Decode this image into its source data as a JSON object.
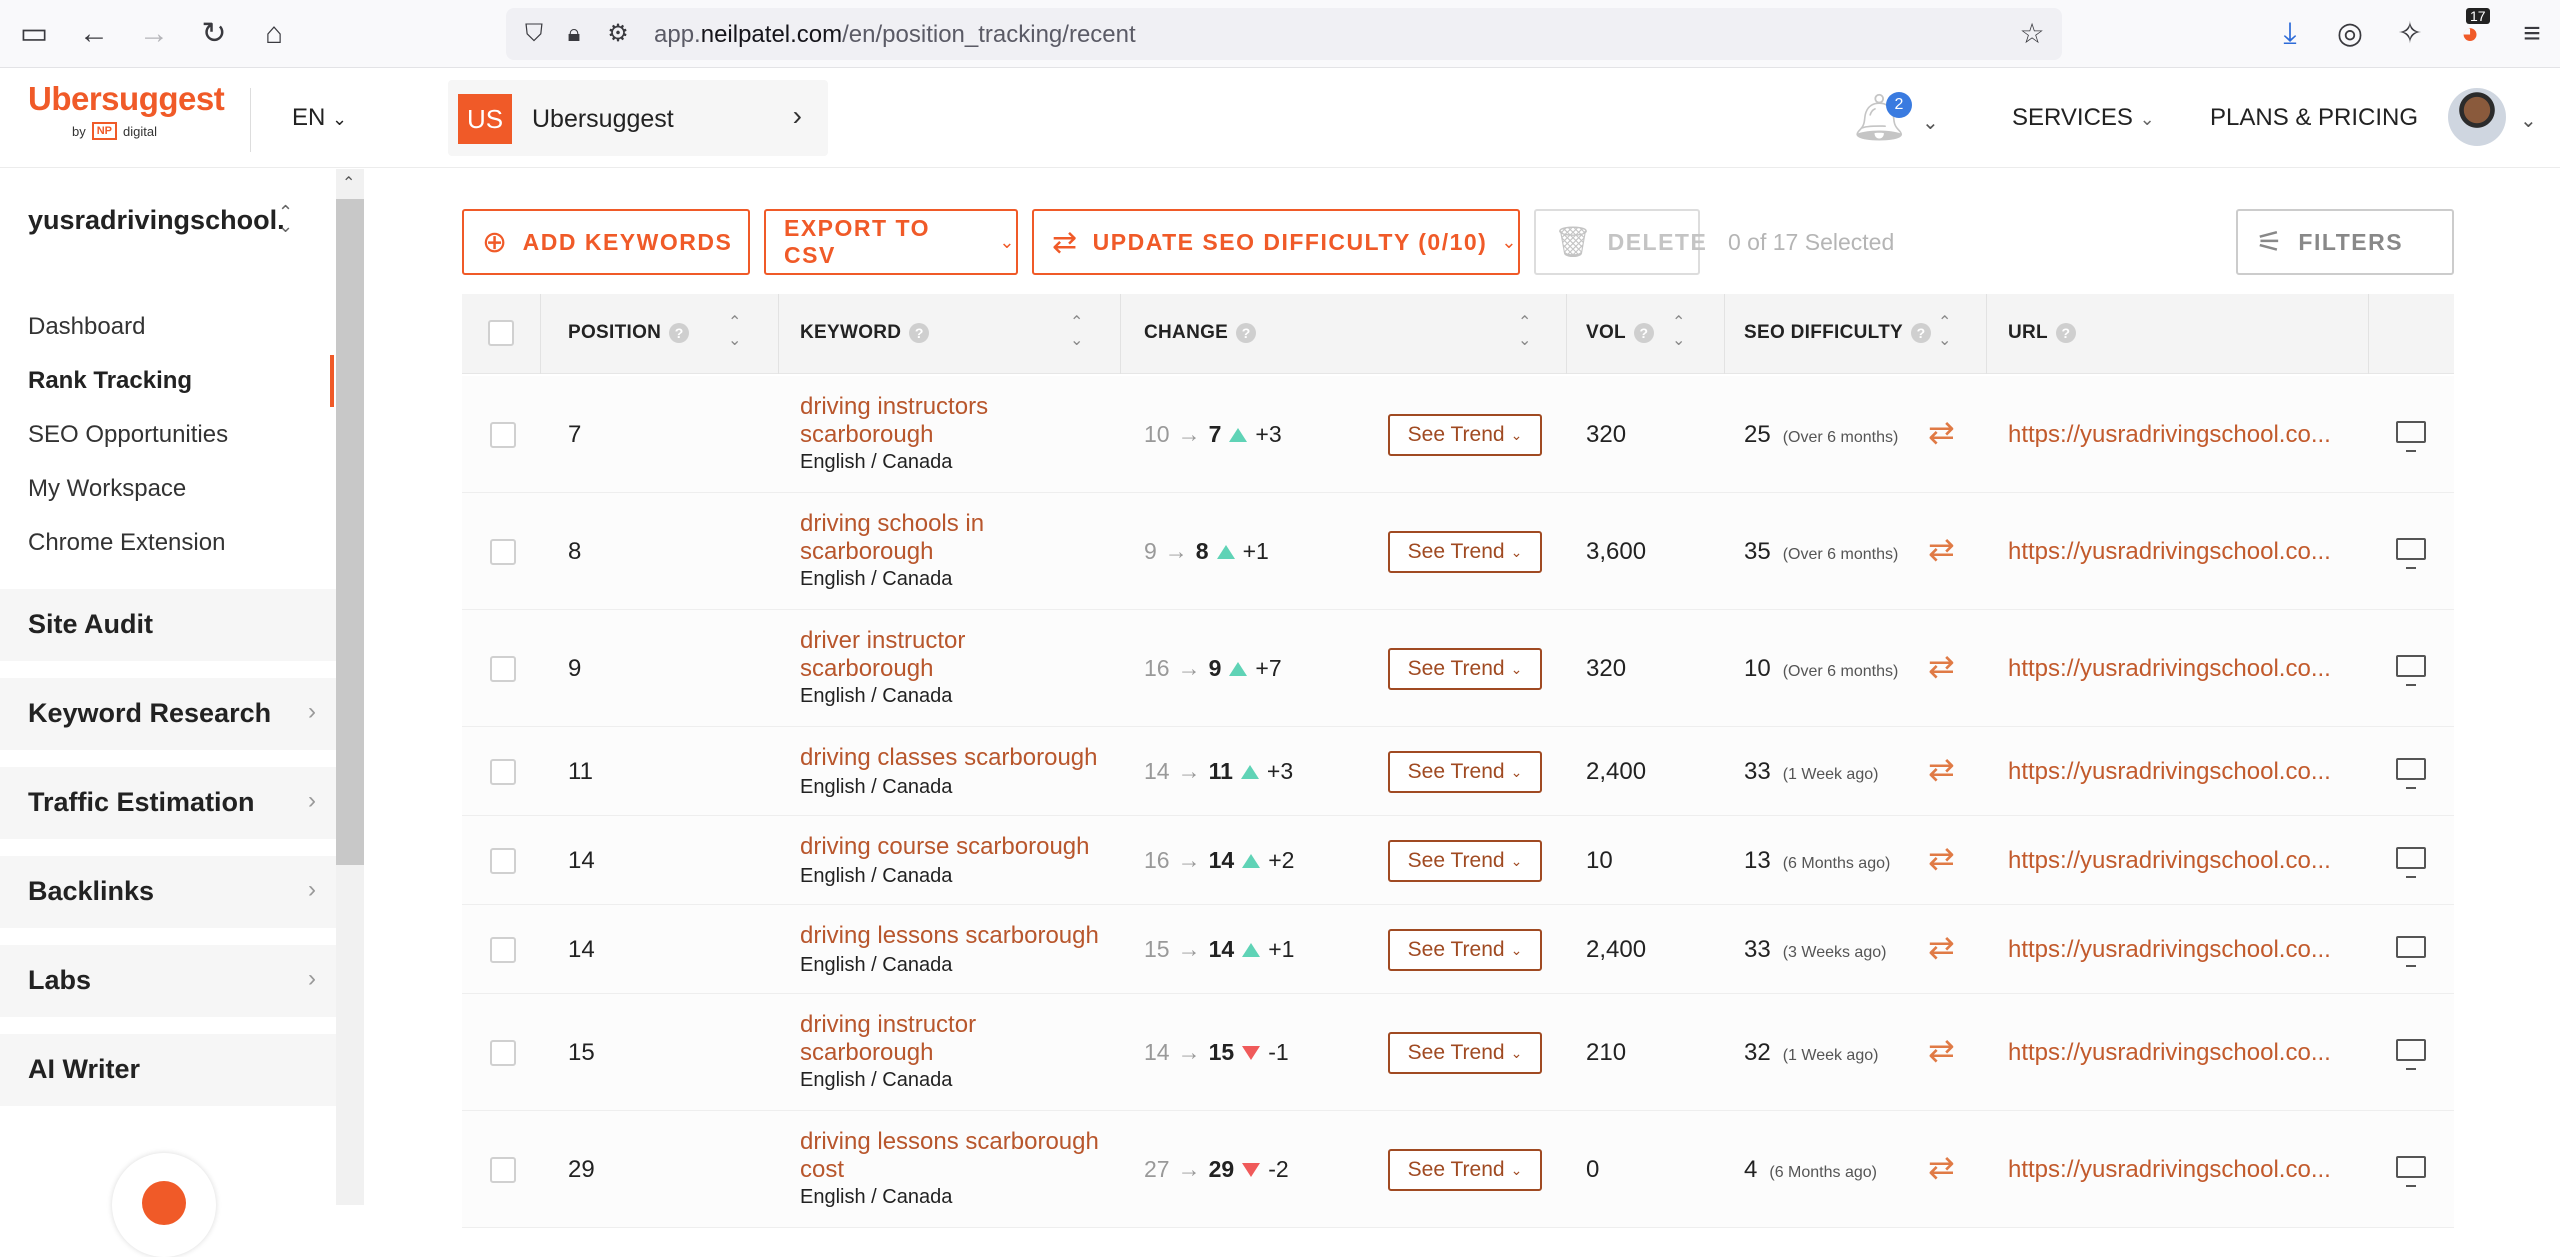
{
  "browser": {
    "url_prefix": "app.",
    "url_domain": "neilpatel.com",
    "url_path": "/en/position_tracking/recent",
    "extensions_badge": "17"
  },
  "header": {
    "logo": "Ubersuggest",
    "logo_by": "by",
    "logo_np": "NP",
    "logo_digital": "digital",
    "language": "EN",
    "project_badge": "US",
    "project_name": "Ubersuggest",
    "notifications_count": "2",
    "services": "SERVICES",
    "plans": "PLANS & PRICING"
  },
  "sidebar": {
    "site": "yusradrivingschool.",
    "items": [
      "Dashboard",
      "Rank Tracking",
      "SEO Opportunities",
      "My Workspace",
      "Chrome Extension"
    ],
    "sections": [
      "Site Audit",
      "Keyword Research",
      "Traffic Estimation",
      "Backlinks",
      "Labs",
      "AI Writer"
    ]
  },
  "toolbar": {
    "add_keywords": "ADD KEYWORDS",
    "export_csv": "EXPORT TO CSV",
    "update_seo": "UPDATE SEO DIFFICULTY (0/10)",
    "delete": "DELETE",
    "selected": "0 of 17 Selected",
    "filters": "FILTERS"
  },
  "table": {
    "columns": [
      "POSITION",
      "KEYWORD",
      "CHANGE",
      "VOL",
      "SEO DIFFICULTY",
      "URL"
    ],
    "trend_label": "See Trend",
    "rows": [
      {
        "position": "7",
        "kw1": "driving instructors",
        "kw2": "scarborough",
        "loc": "English / Canada",
        "from": "10",
        "to": "7",
        "dir": "up",
        "delta": "+3",
        "vol": "320",
        "sd": "25",
        "sd_note": "(Over 6 months)",
        "url": "https://yusradrivingschool.co..."
      },
      {
        "position": "8",
        "kw1": "driving schools in",
        "kw2": "scarborough",
        "loc": "English / Canada",
        "from": "9",
        "to": "8",
        "dir": "up",
        "delta": "+1",
        "vol": "3,600",
        "sd": "35",
        "sd_note": "(Over 6 months)",
        "url": "https://yusradrivingschool.co..."
      },
      {
        "position": "9",
        "kw1": "driver instructor",
        "kw2": "scarborough",
        "loc": "English / Canada",
        "from": "16",
        "to": "9",
        "dir": "up",
        "delta": "+7",
        "vol": "320",
        "sd": "10",
        "sd_note": "(Over 6 months)",
        "url": "https://yusradrivingschool.co..."
      },
      {
        "position": "11",
        "kw1": "driving classes scarborough",
        "kw2": "",
        "loc": "English / Canada",
        "from": "14",
        "to": "11",
        "dir": "up",
        "delta": "+3",
        "vol": "2,400",
        "sd": "33",
        "sd_note": "(1 Week ago)",
        "url": "https://yusradrivingschool.co..."
      },
      {
        "position": "14",
        "kw1": "driving course scarborough",
        "kw2": "",
        "loc": "English / Canada",
        "from": "16",
        "to": "14",
        "dir": "up",
        "delta": "+2",
        "vol": "10",
        "sd": "13",
        "sd_note": "(6 Months ago)",
        "url": "https://yusradrivingschool.co..."
      },
      {
        "position": "14",
        "kw1": "driving lessons scarborough",
        "kw2": "",
        "loc": "English / Canada",
        "from": "15",
        "to": "14",
        "dir": "up",
        "delta": "+1",
        "vol": "2,400",
        "sd": "33",
        "sd_note": "(3 Weeks ago)",
        "url": "https://yusradrivingschool.co..."
      },
      {
        "position": "15",
        "kw1": "driving instructor",
        "kw2": "scarborough",
        "loc": "English / Canada",
        "from": "14",
        "to": "15",
        "dir": "down",
        "delta": "-1",
        "vol": "210",
        "sd": "32",
        "sd_note": "(1 Week ago)",
        "url": "https://yusradrivingschool.co..."
      },
      {
        "position": "29",
        "kw1": "driving lessons scarborough",
        "kw2": "cost",
        "loc": "English / Canada",
        "from": "27",
        "to": "29",
        "dir": "down",
        "delta": "-2",
        "vol": "0",
        "sd": "4",
        "sd_note": "(6 Months ago)",
        "url": "https://yusradrivingschool.co..."
      }
    ]
  }
}
